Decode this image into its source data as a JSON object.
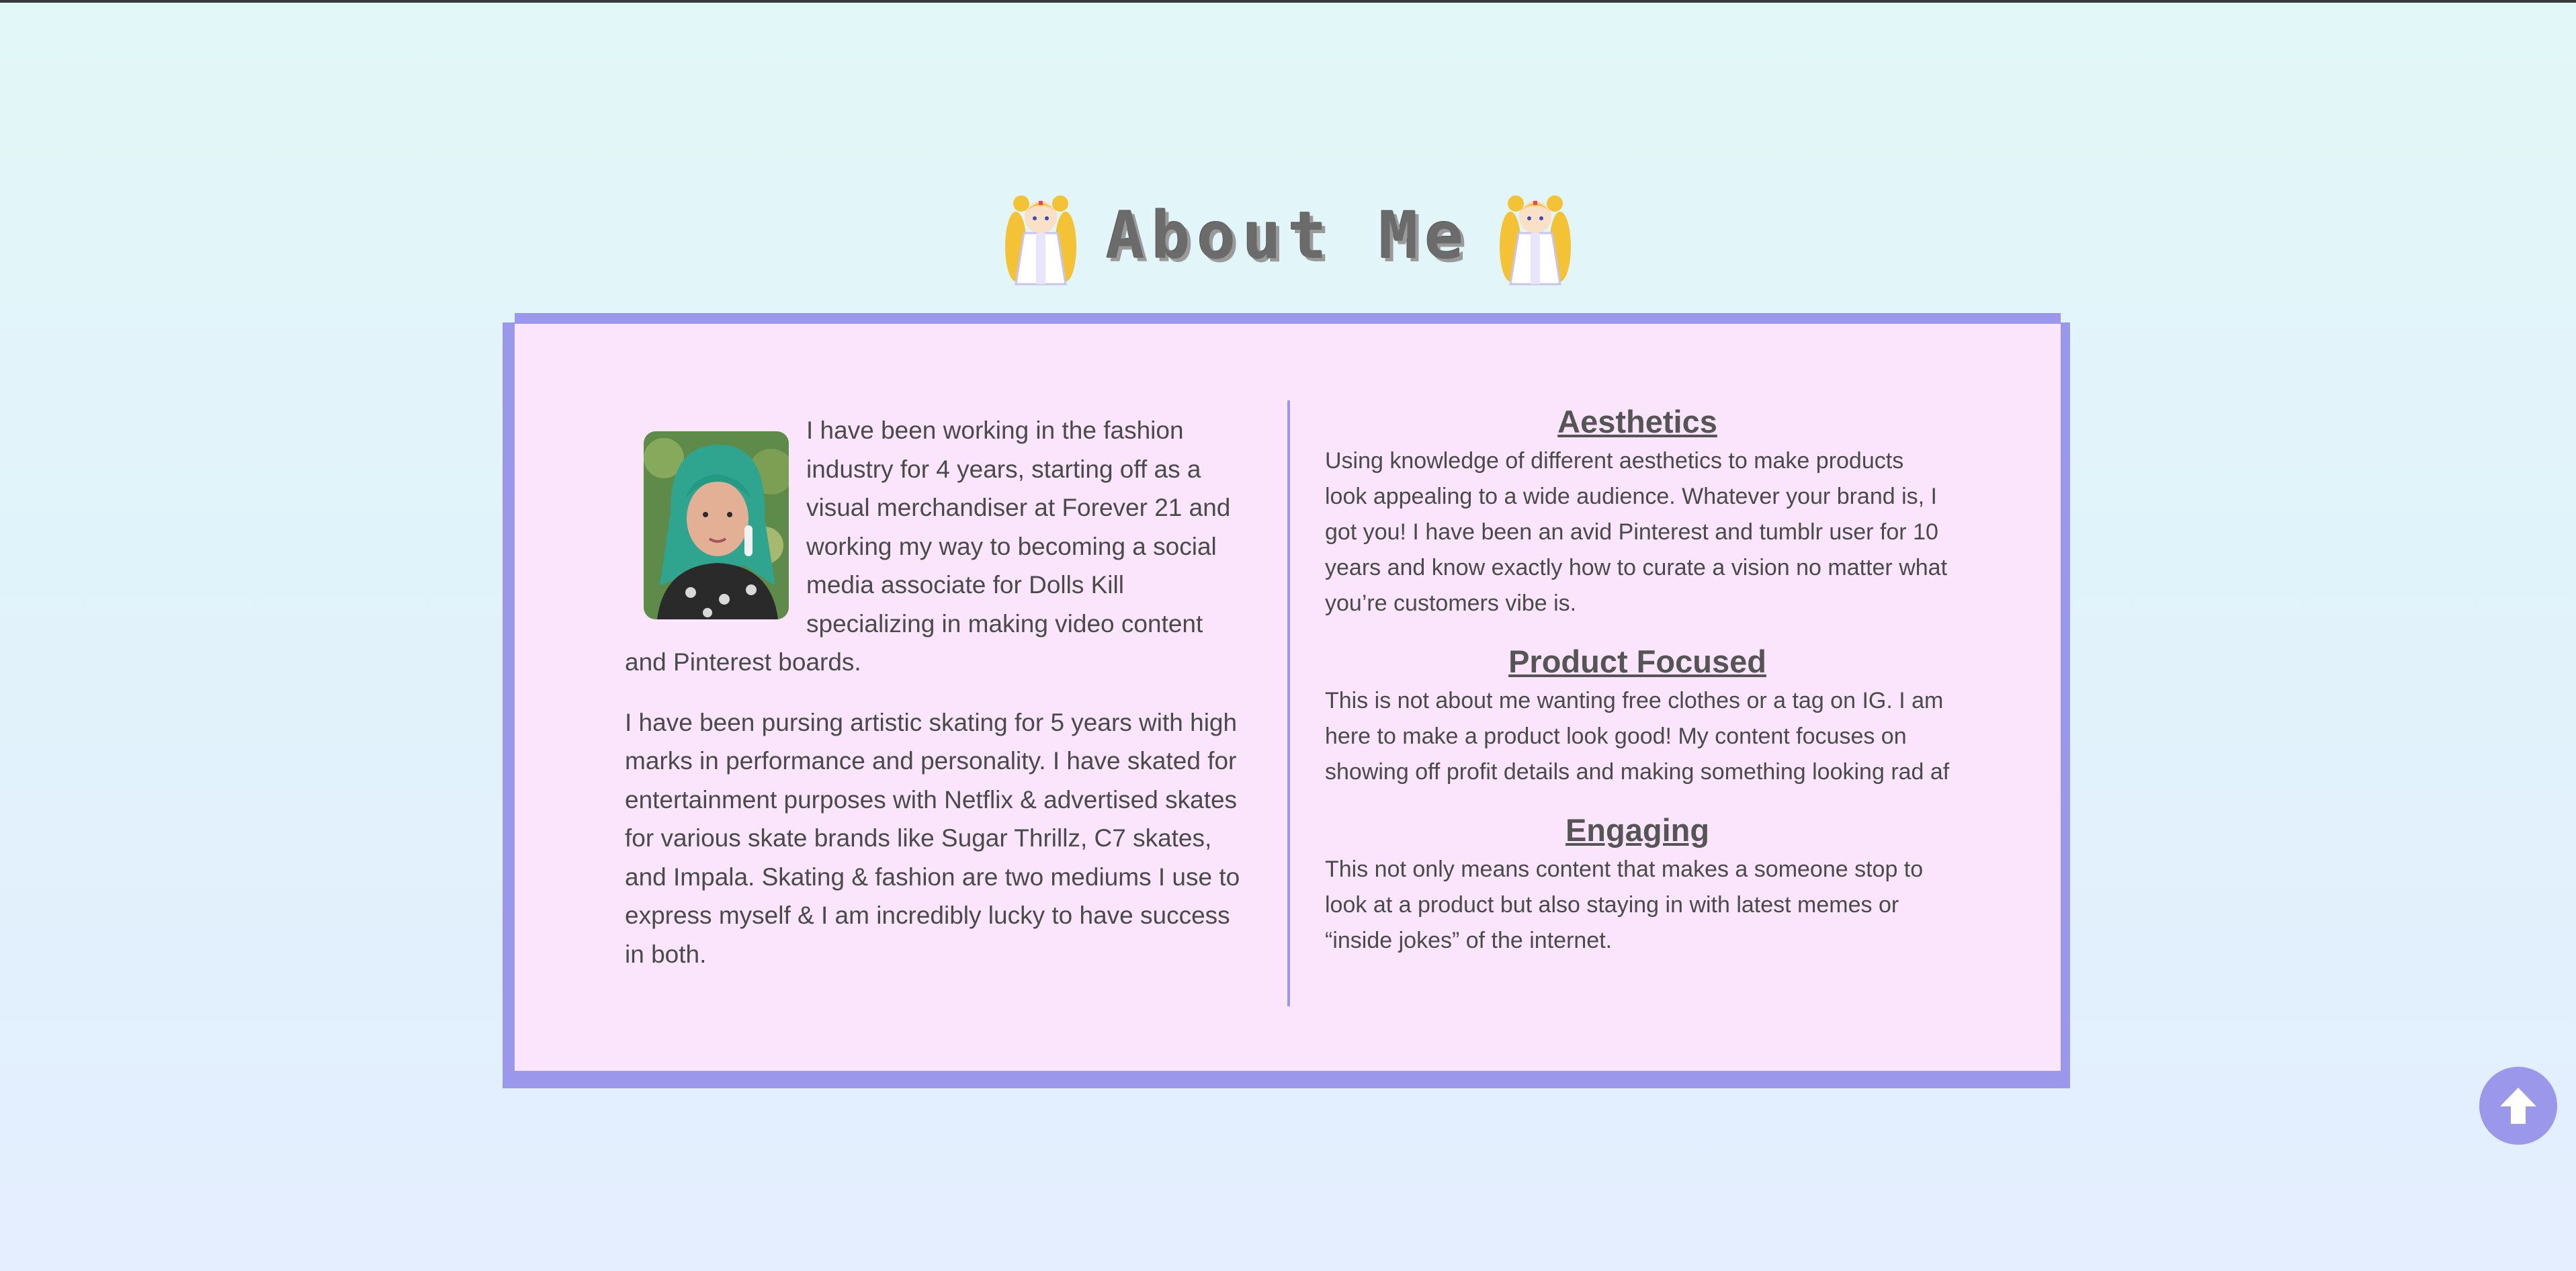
{
  "header": {
    "title": "About Me",
    "left_icon": "sailor-moon-mascot-icon",
    "right_icon": "sailor-moon-mascot-icon"
  },
  "about": {
    "avatar": "profile-photo",
    "paragraph_1": "I have been working in the fashion industry for 4 years, starting off as a visual merchandiser at Forever 21 and working my way to becoming a social media associate for Dolls Kill specializing in making video content and Pinterest boards.",
    "paragraph_2": "I have been pursing artistic skating for 5 years with high marks in performance and personality. I have skated for entertainment purposes with Netflix & advertised skates for various skate brands like Sugar Thrillz, C7 skates, and Impala. Skating & fashion are two mediums I use to express myself & I am incredibly lucky to have success in both."
  },
  "sections": [
    {
      "heading": "Aesthetics",
      "body": "Using knowledge of different aesthetics to make products look appealing to a wide audience. Whatever your brand is, I got you! I have been an avid Pinterest and tumblr user for 10 years and know exactly how to curate a vision no matter what you’re customers vibe is."
    },
    {
      "heading": "Product Focused",
      "body": "This is not about me wanting free clothes or a tag on IG. I am here to make a product look good! My content focuses on showing off profit details and making something looking rad af"
    },
    {
      "heading": "Engaging",
      "body": "This not only means content that makes a someone stop to look at a product but also staying in with latest memes or “inside jokes” of the internet."
    }
  ],
  "scroll_top": {
    "icon": "arrow-up-icon"
  },
  "colors": {
    "background": "#e2f7f8",
    "card": "#fbe5fd",
    "accent": "#9b97ea",
    "text": "#4a4a4a"
  }
}
